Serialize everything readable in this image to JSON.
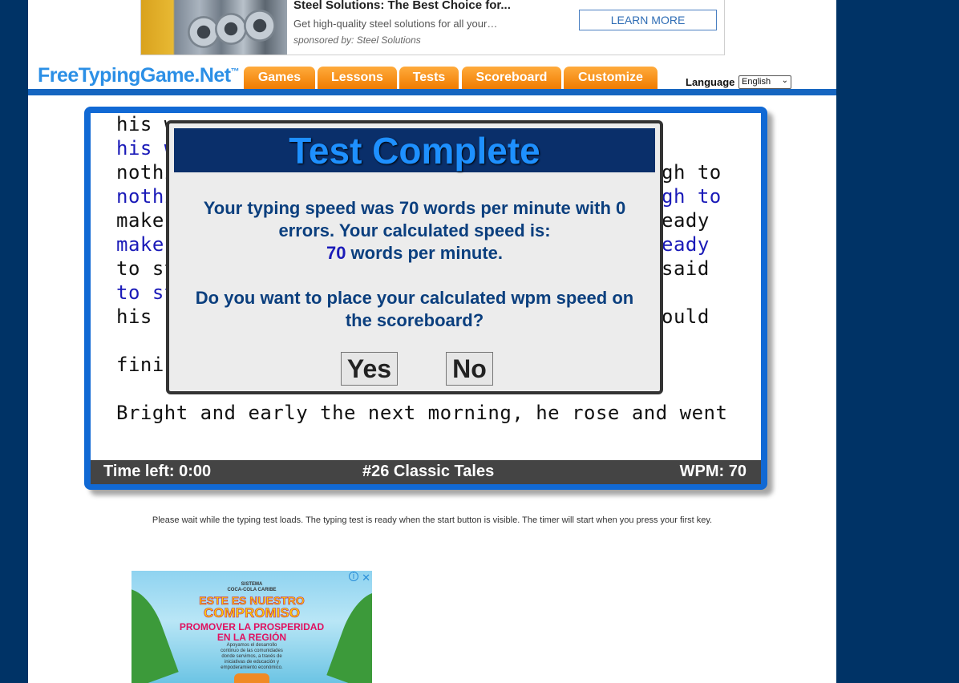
{
  "top_ad": {
    "title": "Steel Solutions: The Best Choice for...",
    "description": "Get high-quality steel solutions for all your…",
    "sponsor": "sponsored by: Steel Solutions",
    "button": "LEARN MORE"
  },
  "header": {
    "logo": "FreeTypingGame.Net",
    "logo_tm": "™",
    "nav": [
      "Games",
      "Lessons",
      "Tests",
      "Scoreboard",
      "Customize"
    ],
    "language_label": "Language",
    "language_value": "English"
  },
  "typing": {
    "lines": [
      {
        "text": "his w",
        "typed": false
      },
      {
        "text": "his w",
        "typed": true
      },
      {
        "text": "nothi",
        "typed": false
      },
      {
        "text": "nothi",
        "typed": true
      },
      {
        "text": "make ",
        "typed": false
      },
      {
        "text": "make ",
        "typed": true
      },
      {
        "text": "to st",
        "typed": false
      },
      {
        "text": "to st",
        "typed": true
      },
      {
        "text": "his p",
        "typed": false
      },
      {
        "text": "finis",
        "typed": false
      },
      {
        "text": "Bright and early the next morning, he rose and went",
        "typed": false
      }
    ],
    "right_fragments": [
      {
        "text": "gh to",
        "typed": false
      },
      {
        "text": "gh to",
        "typed": true
      },
      {
        "text": "eady",
        "typed": false
      },
      {
        "text": "eady",
        "typed": true
      },
      {
        "text": "said",
        "typed": false
      },
      {
        "text": "ould",
        "typed": false
      }
    ]
  },
  "status": {
    "time_left": "Time left: 0:00",
    "test_name": "#26 Classic Tales",
    "wpm": "WPM: 70"
  },
  "modal": {
    "title": "Test Complete",
    "line1": "Your typing speed was 70 words per minute with 0",
    "line2": "errors. Your calculated speed is:",
    "speed_value": "70",
    "speed_suffix": " words per minute.",
    "question1": "Do you want to place your calculated wpm speed on",
    "question2": "the scoreboard?",
    "yes": "Yes",
    "no": "No"
  },
  "wait_text": "Please wait while the typing test loads. The typing test is ready when the start button is visible. The timer will start when you press your first key.",
  "bottom_ad": {
    "line1": "SISTEMA",
    "line2": "COCA-COLA CARIBE",
    "line3": "ESTE ES NUESTRO",
    "line4": "COMPROMISO",
    "line5": "PROMOVER LA PROSPERIDAD",
    "line6": "EN LA REGIÓN",
    "line7": "Apoyamos el desarrollo",
    "line8": "continuo de las comunidades",
    "line9": "donde servimos, a través de",
    "line10": "iniciativas de educación y",
    "line11": "empoderamiento económico.",
    "close": "✕",
    "info": "i"
  },
  "colors": {
    "background": "#003366",
    "nav_orange": "#f07c00",
    "frame_blue": "#1169d4",
    "modal_title_bg": "#0a2f6a",
    "modal_text": "#0b3f7e"
  }
}
